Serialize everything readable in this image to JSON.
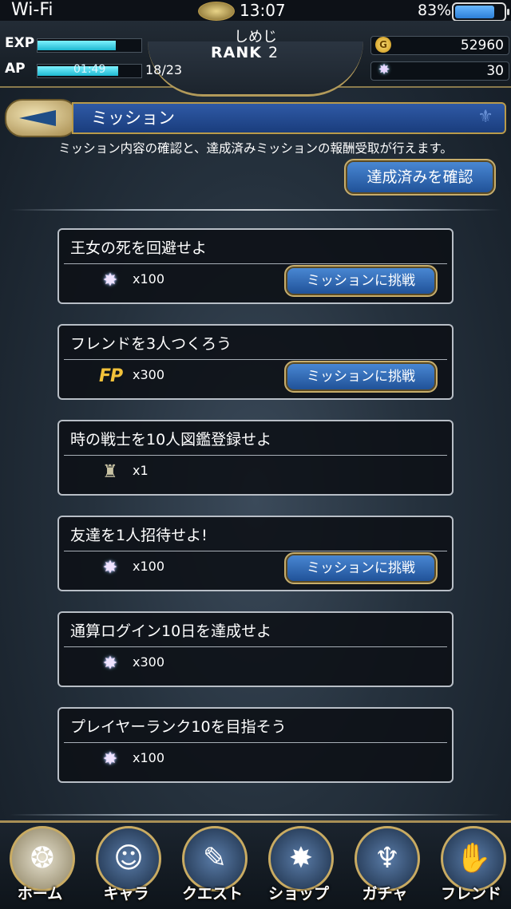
{
  "status_bar": {
    "network": "Wi-Fi",
    "time": "13:07",
    "battery": "83%",
    "battery_level": 0.83
  },
  "player": {
    "name": "しめじ",
    "rank_label": "RANK",
    "rank_value": "2",
    "exp_label": "EXP",
    "exp_progress": 0.75,
    "ap_label": "AP",
    "ap_timer": "01:49",
    "ap_count": "18/23",
    "ap_progress": 0.78
  },
  "currency": {
    "gil": "52960",
    "crystals": "30"
  },
  "header": {
    "title": "ミッション",
    "description": "ミッション内容の確認と、達成済みミッションの報酬受取が行えます。",
    "confirm_button": "達成済みを確認"
  },
  "missions": [
    {
      "title": "王女の死を回避せよ",
      "reward_icon": "crystal-icon",
      "reward_qty": "x100",
      "button": "ミッションに挑戦"
    },
    {
      "title": "フレンドを3人つくろう",
      "reward_icon": "fp-icon",
      "reward_qty": "x300",
      "button": "ミッションに挑戦"
    },
    {
      "title": "時の戦士を10人図鑑登録せよ",
      "reward_icon": "knight-icon",
      "reward_qty": "x1",
      "button": ""
    },
    {
      "title": "友達を1人招待せよ!",
      "reward_icon": "crystal-icon",
      "reward_qty": "x100",
      "button": "ミッションに挑戦"
    },
    {
      "title": "通算ログイン10日を達成せよ",
      "reward_icon": "crystal-icon",
      "reward_qty": "x300",
      "button": ""
    },
    {
      "title": "プレイヤーランク10を目指そう",
      "reward_icon": "crystal-icon",
      "reward_qty": "x100",
      "button": ""
    }
  ],
  "nav": [
    {
      "label": "ホーム",
      "icon": "home-icon",
      "active": true
    },
    {
      "label": "キャラ",
      "icon": "character-icon"
    },
    {
      "label": "クエスト",
      "icon": "quest-icon"
    },
    {
      "label": "ショップ",
      "icon": "shop-icon"
    },
    {
      "label": "ガチャ",
      "icon": "gacha-icon"
    },
    {
      "label": "フレンド",
      "icon": "friend-icon"
    }
  ]
}
